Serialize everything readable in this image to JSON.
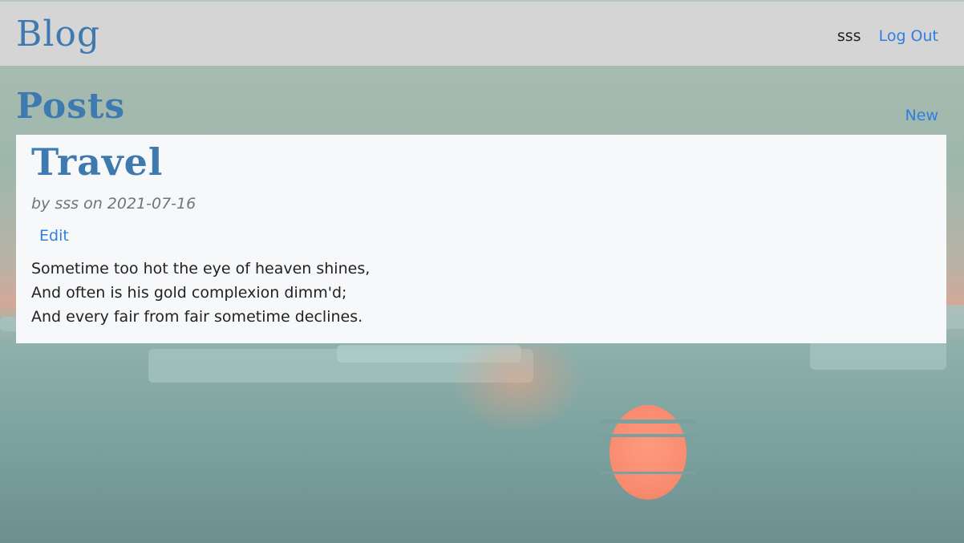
{
  "navbar": {
    "brand": "Blog",
    "username": "sss",
    "logout_label": "Log Out"
  },
  "main": {
    "heading": "Posts",
    "new_label": "New"
  },
  "posts": [
    {
      "title": "Travel",
      "meta": "by sss on 2021-07-16",
      "edit_label": "Edit",
      "body_lines": [
        "Sometime too hot the eye of heaven shines,",
        "And often is his gold complexion dimm'd;",
        "And every fair from fair sometime declines."
      ]
    }
  ],
  "colors": {
    "brand_blue": "#3e7ab0",
    "link_blue": "#2f7fe0",
    "navbar_bg": "#d5d5d5",
    "card_bg": "#f7f8fa",
    "meta_gray": "#6c757d"
  }
}
